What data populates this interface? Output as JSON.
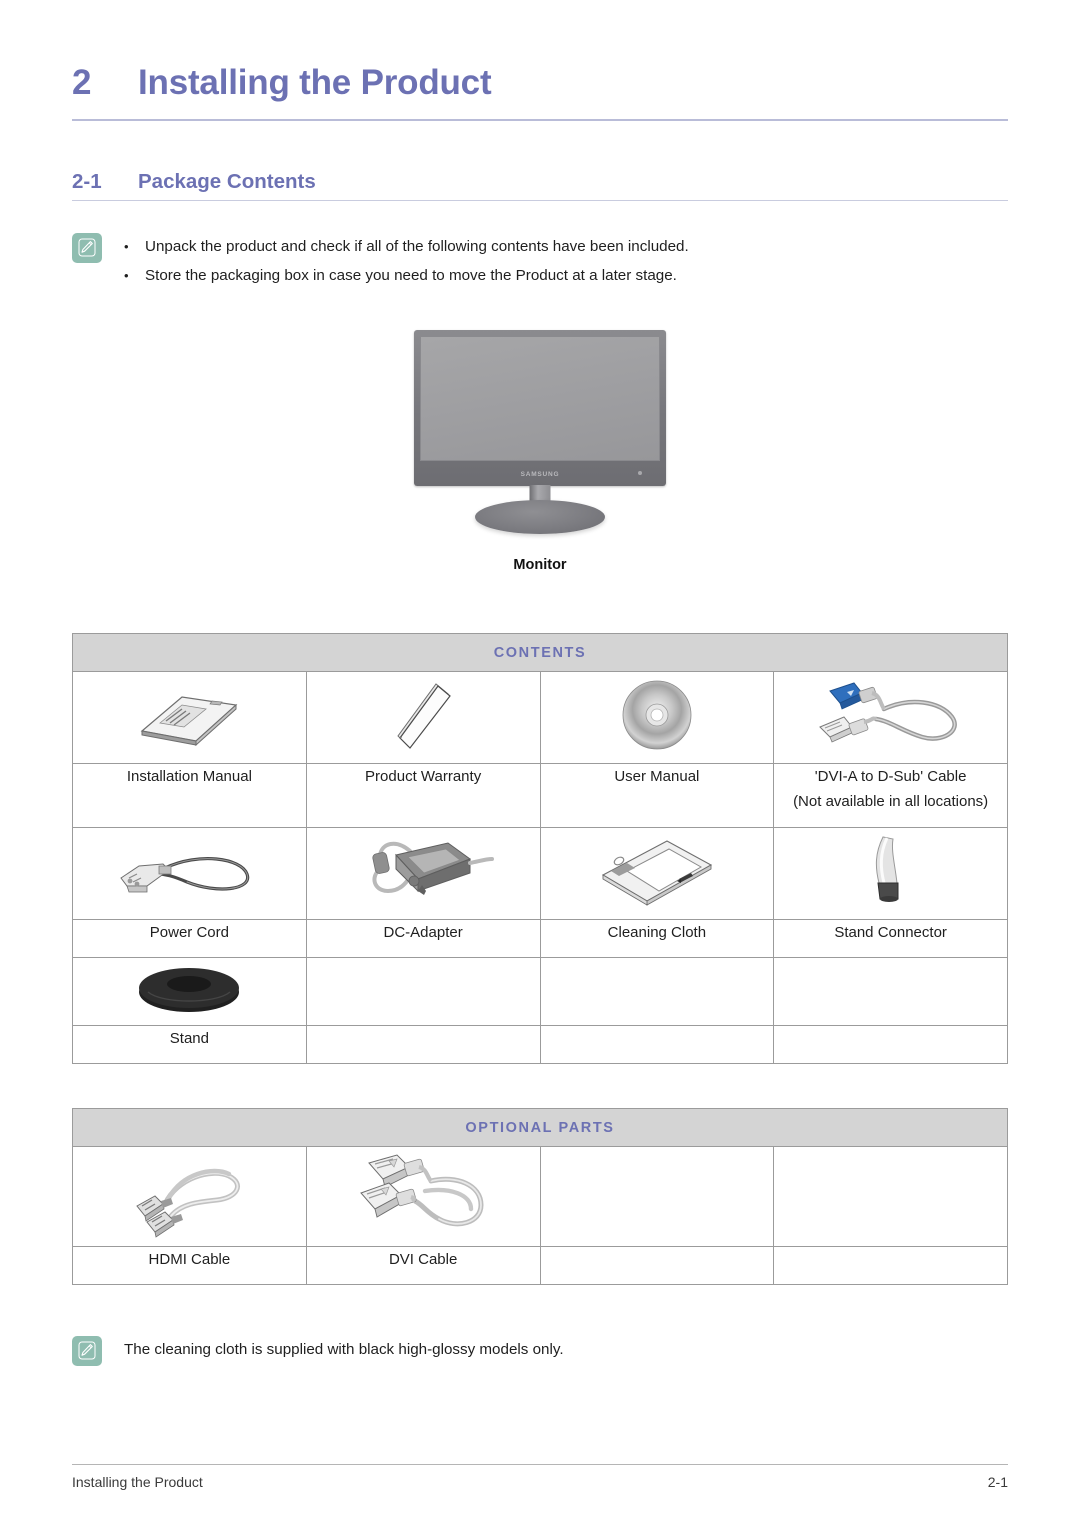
{
  "chapter": {
    "number": "2",
    "title": "Installing the Product"
  },
  "section": {
    "number": "2-1",
    "title": "Package Contents"
  },
  "notes": {
    "top": {
      "icon": "note-pencil-icon",
      "bullet": "•",
      "lines": [
        "Unpack the product and check if all of the following contents have been included.",
        "Store the packaging box in case you need to move the Product at a later stage."
      ]
    },
    "bottom": {
      "icon": "note-pencil-icon",
      "lines": [
        "The cleaning cloth is supplied with black high-glossy models only."
      ]
    }
  },
  "hero": {
    "caption": "Monitor",
    "brand": "SAMSUNG",
    "icon": "monitor-icon"
  },
  "tables": [
    {
      "id": "contents",
      "band_label": "CONTENTS",
      "rows": [
        [
          {
            "label": "Installation Manual",
            "icon": "installation-manual-icon"
          },
          {
            "label": "Product Warranty",
            "icon": "product-warranty-icon"
          },
          {
            "label": "User Manual",
            "icon": "user-manual-disc-icon"
          },
          {
            "label": "'DVI-A to D-Sub' Cable",
            "sublabel": "(Not available in all locations)",
            "icon": "dvi-a-to-dsub-cable-icon"
          }
        ],
        [
          {
            "label": "Power Cord",
            "icon": "power-cord-icon"
          },
          {
            "label": "DC-Adapter",
            "icon": "dc-adapter-icon"
          },
          {
            "label": "Cleaning Cloth",
            "icon": "cleaning-cloth-icon"
          },
          {
            "label": "Stand Connector",
            "icon": "stand-connector-icon"
          }
        ],
        [
          {
            "label": "Stand",
            "icon": "stand-icon"
          },
          {
            "label": "",
            "icon": ""
          },
          {
            "label": "",
            "icon": ""
          },
          {
            "label": "",
            "icon": ""
          }
        ]
      ]
    },
    {
      "id": "optional",
      "band_label": "OPTIONAL PARTS",
      "rows": [
        [
          {
            "label": "HDMI Cable",
            "icon": "hdmi-cable-icon"
          },
          {
            "label": "DVI Cable",
            "icon": "dvi-cable-icon"
          },
          {
            "label": "",
            "icon": ""
          },
          {
            "label": "",
            "icon": ""
          }
        ]
      ]
    }
  ],
  "footer": {
    "left": "Installing the Product",
    "right": "2-1"
  },
  "colors": {
    "accent_purple": "#6c71b3",
    "band_gray": "#d4d4d4",
    "note_teal": "#8fbdb0",
    "rule": "#9b9b9b"
  }
}
